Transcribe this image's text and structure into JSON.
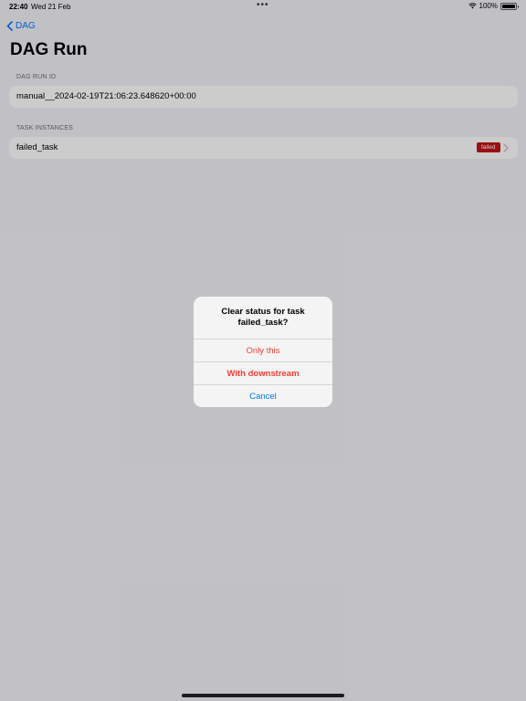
{
  "status_bar": {
    "time": "22:40",
    "date": "Wed 21 Feb",
    "dots": "•••",
    "battery": "100%"
  },
  "nav": {
    "back_label": "DAG",
    "title": "DAG Run"
  },
  "run_section": {
    "header": "DAG RUN ID",
    "value": "manual__2024-02-19T21:06:23.648620+00:00"
  },
  "tasks_section": {
    "header": "TASK INSTANCES",
    "items": [
      {
        "name": "failed_task",
        "status": "failed"
      }
    ]
  },
  "alert": {
    "title": "Clear status for task failed_task?",
    "buttons": {
      "only_this": "Only this",
      "with_downstream": "With downstream",
      "cancel": "Cancel"
    }
  },
  "colors": {
    "accent": "#007aff",
    "destructive": "#ff3b30",
    "failed_badge": "#c0161a",
    "background": "#f2f2f7"
  }
}
